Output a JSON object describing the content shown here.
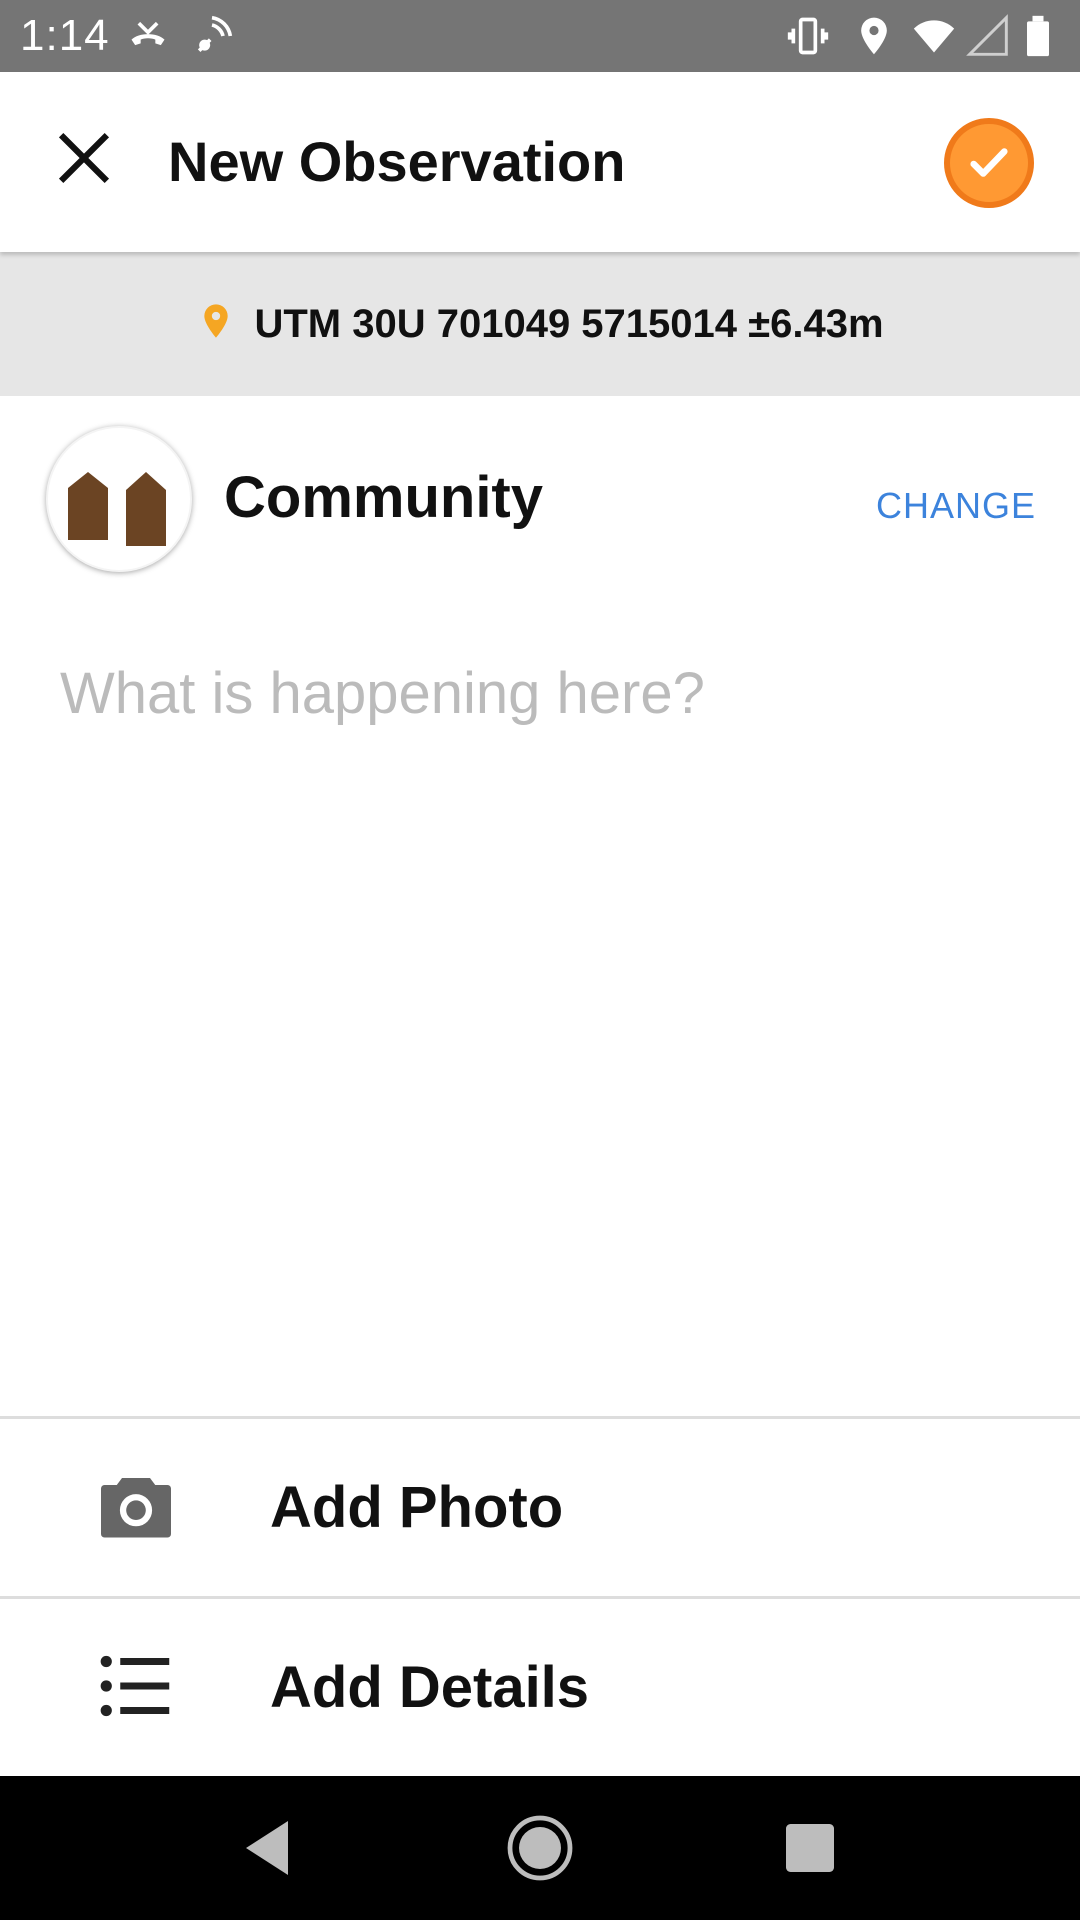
{
  "status_bar": {
    "time": "1:14",
    "icons": [
      "missed-call-icon",
      "cast-icon",
      "vibrate-icon",
      "location-icon",
      "wifi-icon",
      "signal-icon",
      "battery-icon"
    ]
  },
  "toolbar": {
    "title": "New Observation",
    "close_icon": "close-icon",
    "confirm_icon": "checkmark-icon",
    "accent_color": "#ff9933"
  },
  "location": {
    "text": "UTM 30U 701049 5715014 ±6.43m",
    "pin_color": "#f5a623"
  },
  "category": {
    "name": "Community",
    "change_label": "CHANGE",
    "icon": "community-houses-icon",
    "icon_color": "#6b4423"
  },
  "notes": {
    "placeholder": "What is happening here?",
    "value": ""
  },
  "actions": [
    {
      "label": "Add Photo",
      "icon": "camera-icon"
    },
    {
      "label": "Add Details",
      "icon": "list-icon"
    }
  ],
  "nav_bar": {
    "buttons": [
      "back-icon",
      "home-icon",
      "recents-icon"
    ]
  }
}
